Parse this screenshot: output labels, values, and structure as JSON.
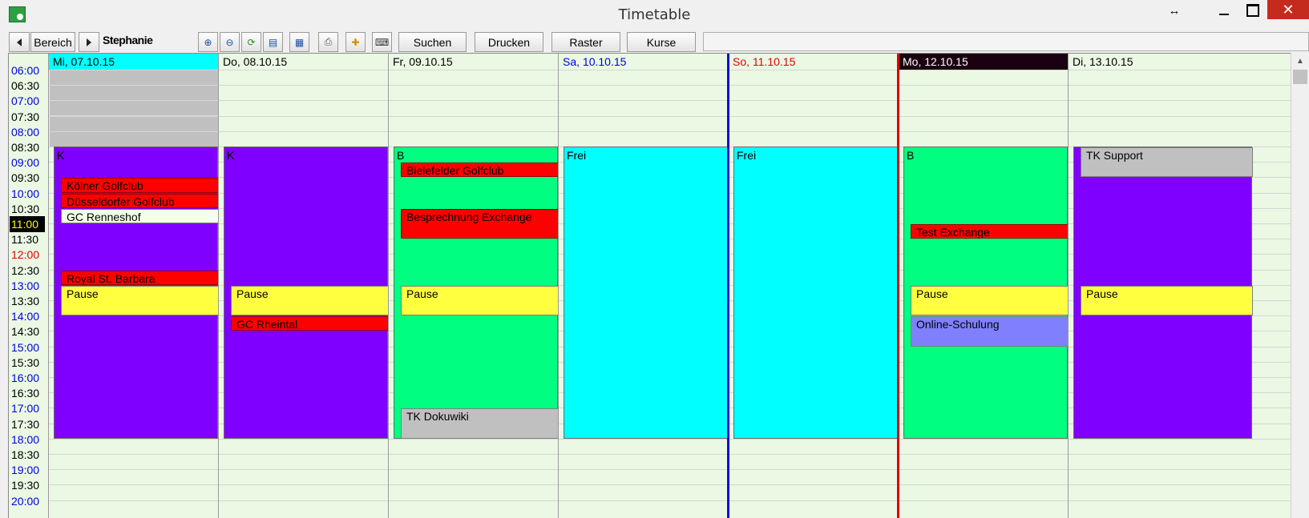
{
  "window": {
    "title": "Timetable",
    "resize_glyph": "↔",
    "close_glyph": "✕"
  },
  "toolbar": {
    "prev_icon": "triangle-left-icon",
    "area_label": "Bereich",
    "next_icon": "triangle-right-icon",
    "user": "Stephanie",
    "icons": [
      "zoom-in-icon",
      "zoom-out-icon",
      "refresh-icon",
      "list-view-icon",
      "calendar-grid-icon",
      "print-preview-icon",
      "new-appointment-icon",
      "keyboard-icon"
    ],
    "search_label": "Suchen",
    "print_label": "Drucken",
    "grid_label": "Raster",
    "courses_label": "Kurse"
  },
  "times": [
    {
      "label": "06:00",
      "color": "#0000dd",
      "highlight": false
    },
    {
      "label": "06:30",
      "color": "#000000",
      "highlight": false
    },
    {
      "label": "07:00",
      "color": "#0000dd",
      "highlight": false
    },
    {
      "label": "07:30",
      "color": "#000000",
      "highlight": false
    },
    {
      "label": "08:00",
      "color": "#0000dd",
      "highlight": false
    },
    {
      "label": "08:30",
      "color": "#000000",
      "highlight": false
    },
    {
      "label": "09:00",
      "color": "#0000dd",
      "highlight": false
    },
    {
      "label": "09:30",
      "color": "#000000",
      "highlight": false
    },
    {
      "label": "10:00",
      "color": "#0000dd",
      "highlight": false
    },
    {
      "label": "10:30",
      "color": "#000000",
      "highlight": false
    },
    {
      "label": "11:00",
      "color": "#ffff00",
      "highlight": true
    },
    {
      "label": "11:30",
      "color": "#000000",
      "highlight": false
    },
    {
      "label": "12:00",
      "color": "#e00000",
      "highlight": false
    },
    {
      "label": "12:30",
      "color": "#000000",
      "highlight": false
    },
    {
      "label": "13:00",
      "color": "#0000dd",
      "highlight": false
    },
    {
      "label": "13:30",
      "color": "#000000",
      "highlight": false
    },
    {
      "label": "14:00",
      "color": "#0000dd",
      "highlight": false
    },
    {
      "label": "14:30",
      "color": "#000000",
      "highlight": false
    },
    {
      "label": "15:00",
      "color": "#0000dd",
      "highlight": false
    },
    {
      "label": "15:30",
      "color": "#000000",
      "highlight": false
    },
    {
      "label": "16:00",
      "color": "#0000dd",
      "highlight": false
    },
    {
      "label": "16:30",
      "color": "#000000",
      "highlight": false
    },
    {
      "label": "17:00",
      "color": "#0000dd",
      "highlight": false
    },
    {
      "label": "17:30",
      "color": "#000000",
      "highlight": false
    },
    {
      "label": "18:00",
      "color": "#0000dd",
      "highlight": false
    },
    {
      "label": "18:30",
      "color": "#000000",
      "highlight": false
    },
    {
      "label": "19:00",
      "color": "#0000dd",
      "highlight": false
    },
    {
      "label": "19:30",
      "color": "#000000",
      "highlight": false
    },
    {
      "label": "20:00",
      "color": "#0000dd",
      "highlight": false
    }
  ],
  "days": [
    {
      "header": "Mi, 07.10.15",
      "header_bg": "#00ffff",
      "header_color": "#000000",
      "block": {
        "label": "K",
        "color": "#8000ff",
        "start": "08:30",
        "end": "18:00"
      },
      "grey_until": "08:30",
      "events": [
        {
          "title": "Kölner Golfclub",
          "start": "09:30",
          "end": "10:00",
          "color": "#ff0000"
        },
        {
          "title": "Düsseldorfer Golfclub",
          "start": "10:00",
          "end": "10:30",
          "color": "#ff0000"
        },
        {
          "title": "GC Renneshof",
          "start": "10:30",
          "end": "11:00",
          "color": "#f4fff0"
        },
        {
          "title": "Royal St. Barbara",
          "start": "12:30",
          "end": "13:00",
          "color": "#ff0000"
        },
        {
          "title": "Pause",
          "start": "13:00",
          "end": "14:00",
          "color": "#ffff40"
        }
      ]
    },
    {
      "header": "Do, 08.10.15",
      "header_bg": "",
      "header_color": "#000000",
      "block": {
        "label": "K",
        "color": "#8000ff",
        "start": "08:30",
        "end": "18:00"
      },
      "grey_until": "",
      "events": [
        {
          "title": "Pause",
          "start": "13:00",
          "end": "14:00",
          "color": "#ffff40"
        },
        {
          "title": "GC Rheintal",
          "start": "14:00",
          "end": "14:30",
          "color": "#ff0000"
        }
      ]
    },
    {
      "header": "Fr, 09.10.15",
      "header_bg": "",
      "header_color": "#000000",
      "block": {
        "label": "B",
        "color": "#00ff80",
        "start": "08:30",
        "end": "18:00"
      },
      "grey_until": "",
      "events": [
        {
          "title": "Bielefelder Golfclub",
          "start": "09:00",
          "end": "09:30",
          "color": "#ff0000"
        },
        {
          "title": "Besprechnung Exchange",
          "start": "10:30",
          "end": "11:30",
          "color": "#ff0000"
        },
        {
          "title": "Pause",
          "start": "13:00",
          "end": "14:00",
          "color": "#ffff40"
        },
        {
          "title": "TK Dokuwiki",
          "start": "17:00",
          "end": "18:00",
          "color": "#c0c0c0"
        }
      ]
    },
    {
      "header": "Sa, 10.10.15",
      "header_bg": "",
      "header_color": "#0000dd",
      "block": {
        "label": "Frei",
        "color": "#00ffff",
        "start": "08:30",
        "end": "18:00"
      },
      "grey_until": "",
      "events": []
    },
    {
      "header": "So, 11.10.15",
      "header_bg": "",
      "header_color": "#e00000",
      "block": {
        "label": "Frei",
        "color": "#00ffff",
        "start": "08:30",
        "end": "18:00"
      },
      "grey_until": "",
      "events": []
    },
    {
      "header": "Mo, 12.10.15",
      "header_bg": "#1a0010",
      "header_color": "#ffffff",
      "block": {
        "label": "B",
        "color": "#00ff80",
        "start": "08:30",
        "end": "18:00"
      },
      "grey_until": "",
      "events": [
        {
          "title": "Test Exchange",
          "start": "11:00",
          "end": "11:30",
          "color": "#ff0000"
        },
        {
          "title": "Pause",
          "start": "13:00",
          "end": "14:00",
          "color": "#ffff40"
        },
        {
          "title": "Online-Schulung",
          "start": "14:00",
          "end": "15:00",
          "color": "#8080ff"
        }
      ]
    },
    {
      "header": "Di, 13.10.15",
      "header_bg": "",
      "header_color": "#000000",
      "block": {
        "label": "",
        "color": "#8000ff",
        "start": "08:30",
        "end": "18:00"
      },
      "grey_until": "",
      "events": [
        {
          "title": "TK Support",
          "start": "08:30",
          "end": "09:30",
          "color": "#c0c0c0"
        },
        {
          "title": "Pause",
          "start": "13:00",
          "end": "14:00",
          "color": "#ffff40"
        }
      ]
    }
  ]
}
